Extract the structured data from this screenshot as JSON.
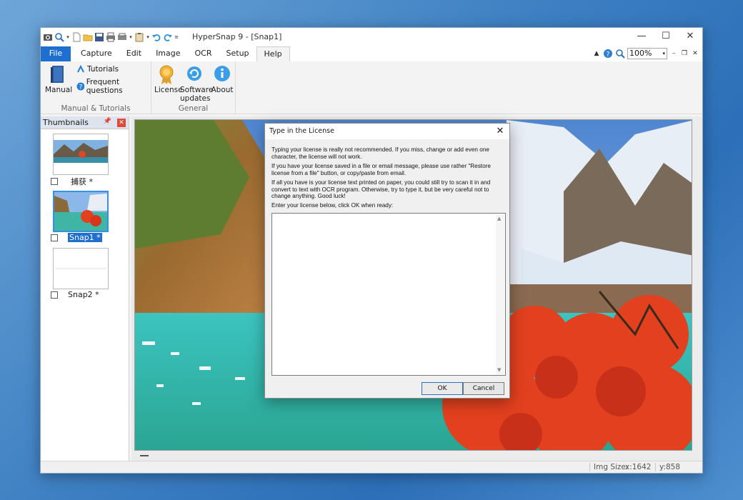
{
  "window": {
    "title": "HyperSnap 9 - [Snap1]"
  },
  "window_controls": {
    "minimize": "—",
    "maximize": "☐",
    "close": "✕"
  },
  "menu": {
    "file": "File",
    "items": [
      "Capture",
      "Edit",
      "Image",
      "OCR",
      "Setup",
      "Help"
    ],
    "active": "Help"
  },
  "zoom": {
    "value": "100%"
  },
  "ribbon": {
    "manual_tutorials": {
      "label": "Manual & Tutorials",
      "manual": "Manual",
      "tutorials": "Tutorials",
      "faq": "Frequent questions"
    },
    "general": {
      "label": "General",
      "license": "License",
      "software_updates_1": "Software",
      "software_updates_2": "updates",
      "about": "About"
    }
  },
  "thumbnails": {
    "title": "Thumbnails",
    "items": [
      {
        "label": "捕获 *",
        "selected": false
      },
      {
        "label": "Snap1 *",
        "selected": true
      },
      {
        "label": "Snap2 *",
        "selected": false
      }
    ]
  },
  "dialog": {
    "title": "Type in the License",
    "para1": "Typing your license is really not recommended. If you miss, change or add even one character, the license will not work.",
    "para2": "If you have your license saved in a file or email message, please use rather \"Restore license from a file\" button, or copy/paste from email.",
    "para3": "If all you have is your license text printed on paper, you could still try to scan it in and convert to text with OCR program. Otherwise, try to type it, but be very careful not to change anything. Good luck!",
    "prompt": "Enter your license below, click OK when ready:",
    "license_value": "",
    "ok": "OK",
    "cancel": "Cancel"
  },
  "status": {
    "img_size_label": "Img Size:",
    "x": "x:1642",
    "y": "y:858"
  },
  "colors": {
    "accent": "#1e6fd0",
    "desktop": "#3d7fc2",
    "selection": "#3a8ee6"
  }
}
